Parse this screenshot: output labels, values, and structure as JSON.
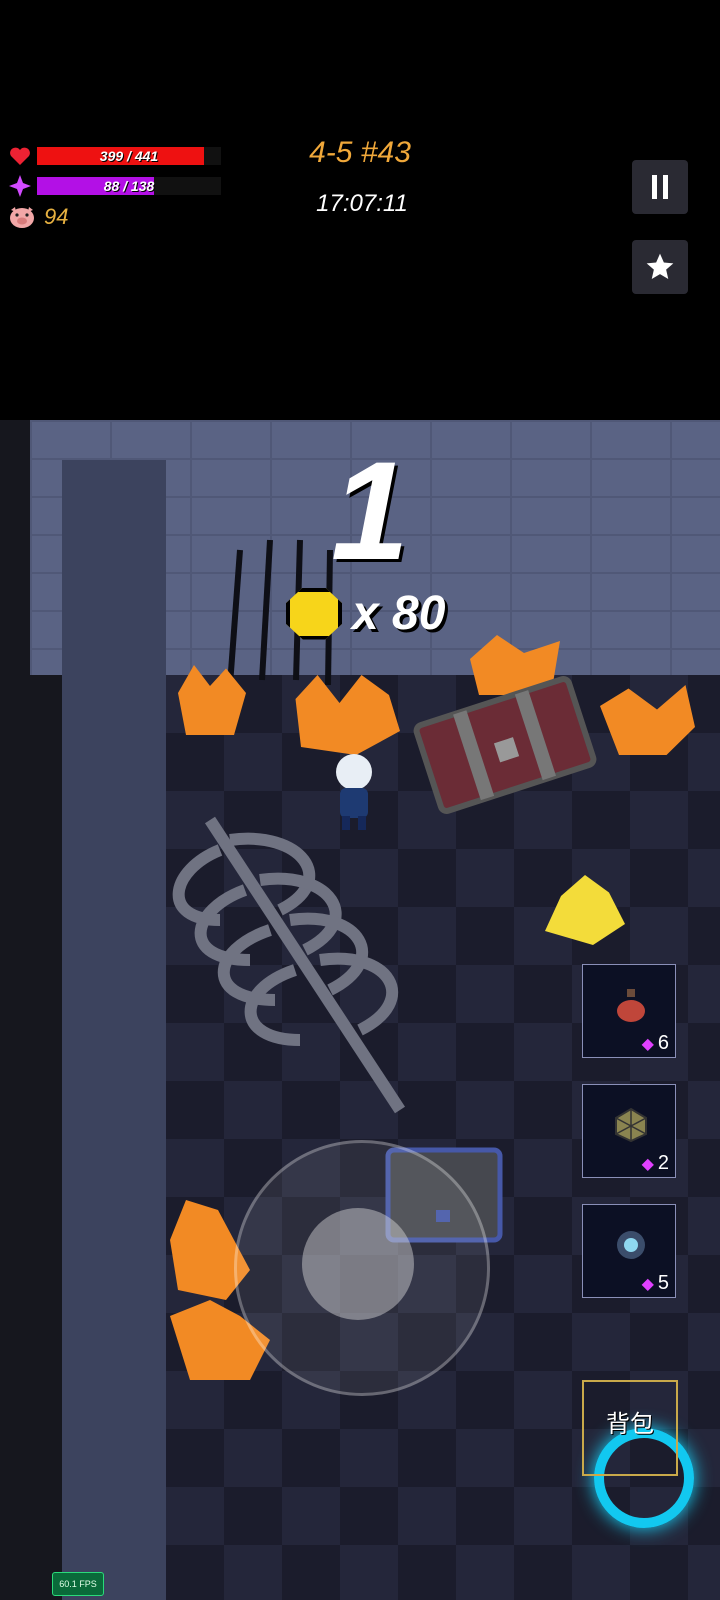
{
  "hud": {
    "hp_text": "399 / 441",
    "hp_fraction": 0.905,
    "mp_text": "88 / 138",
    "mp_fraction": 0.638,
    "coins": "94",
    "level_label": "4-5 #43",
    "timer": "17:07:11",
    "pause_icon": "pause-icon",
    "favorite_icon": "star-icon"
  },
  "popup": {
    "counter": "1",
    "gold_text": "x 80"
  },
  "items": [
    {
      "icon": "potion-icon",
      "count": "6"
    },
    {
      "icon": "polyhedron-icon",
      "count": "2"
    },
    {
      "icon": "orb-icon",
      "count": "5"
    }
  ],
  "backpack": {
    "label": "背包"
  },
  "fps": "60.1 FPS",
  "colors": {
    "hp": "#ee1111",
    "mp": "#b310e6",
    "gold": "#f0a83a",
    "portal": "#12c8f0"
  }
}
